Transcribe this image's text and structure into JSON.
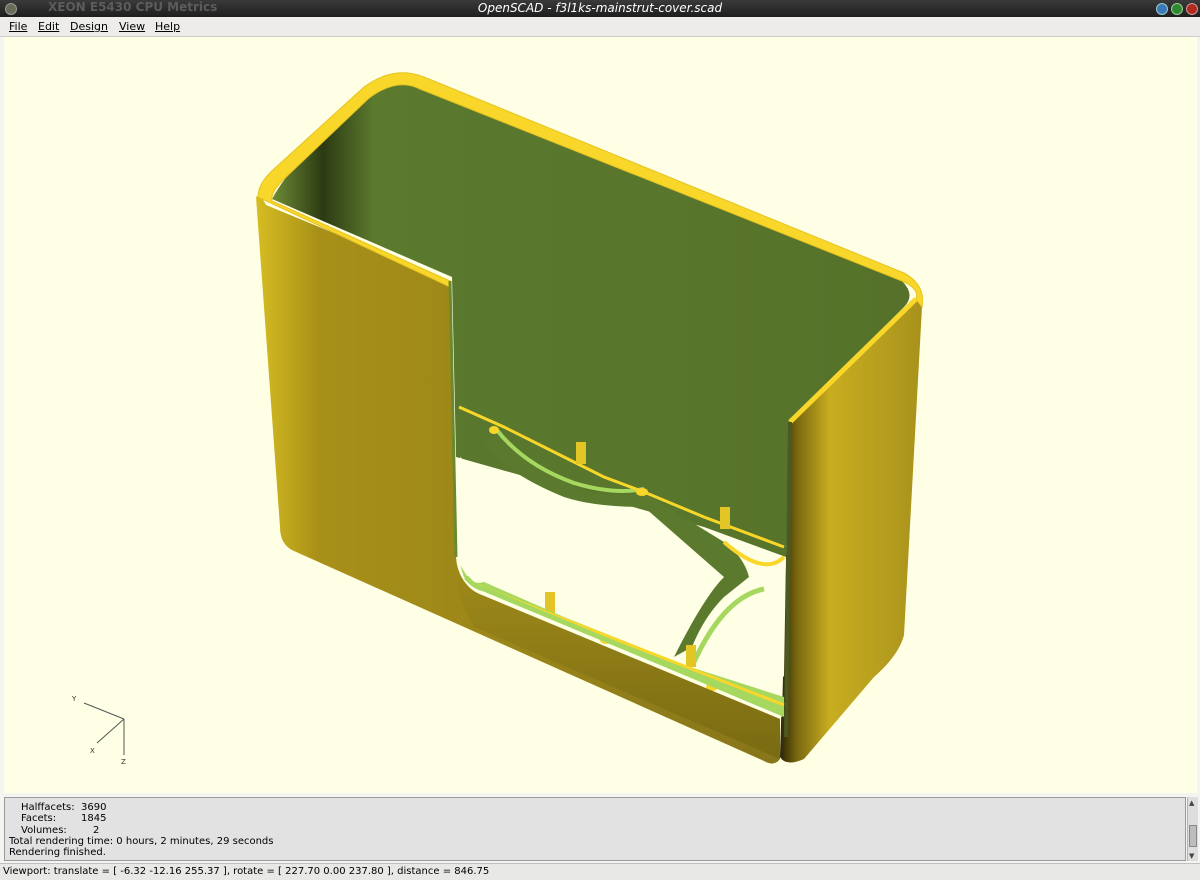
{
  "window": {
    "title": "OpenSCAD - f3l1ks-mainstrut-cover.scad",
    "background_window_title": "XEON E5430 CPU Metrics"
  },
  "menu": {
    "items": [
      {
        "label": "File"
      },
      {
        "label": "Edit"
      },
      {
        "label": "Design"
      },
      {
        "label": "View"
      },
      {
        "label": "Help"
      }
    ]
  },
  "axes": {
    "x": "X",
    "y": "Y",
    "z": "Z"
  },
  "console": {
    "lines": [
      {
        "label": "Halffacets:",
        "value": "3690"
      },
      {
        "label": "Facets:",
        "value": "1845"
      },
      {
        "label": "Volumes:",
        "value": "2"
      }
    ],
    "render_time": "Total rendering time: 0 hours, 2 minutes, 29 seconds",
    "finished": "Rendering finished."
  },
  "status": {
    "viewport": "Viewport: translate = [ -6.32 -12.16 255.37 ], rotate = [ 227.70 0.00 237.80 ], distance = 846.75"
  },
  "colors": {
    "viewport_bg": "#ffffe5",
    "model_outer": "#b8a020",
    "model_rim": "#f8d62a",
    "model_inner": "#5a7a30",
    "model_highlight": "#a6d860"
  }
}
